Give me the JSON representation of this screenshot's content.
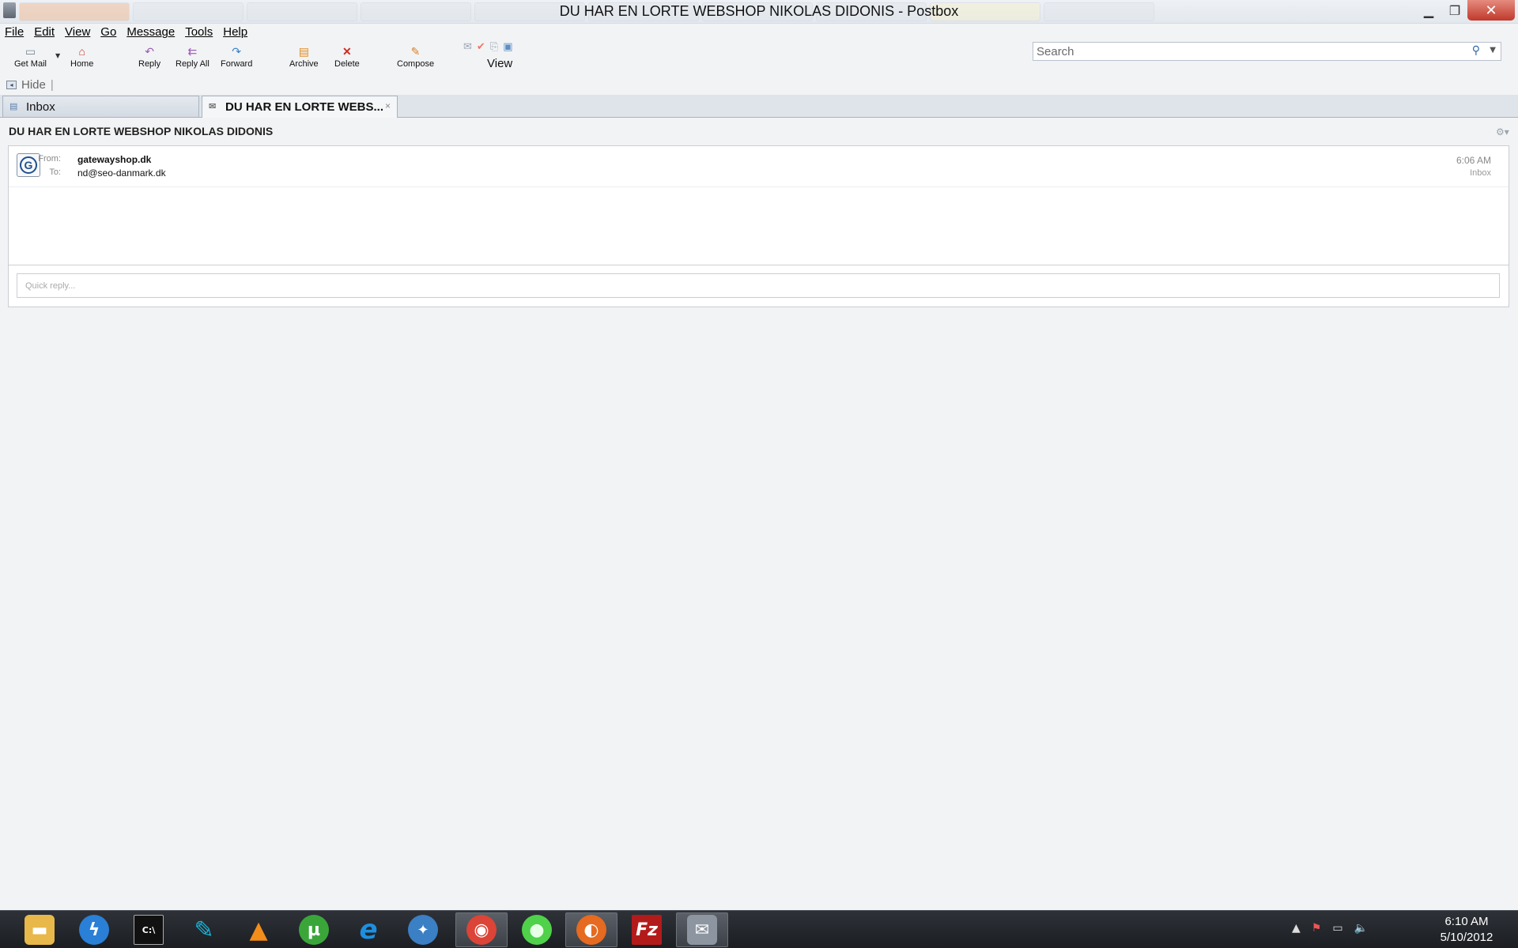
{
  "window": {
    "title": "DU HAR EN LORTE WEBSHOP NIKOLAS DIDONIS - Postbox",
    "minimize": "▁",
    "maximize": "❐",
    "close": "✕"
  },
  "menu": [
    "File",
    "Edit",
    "View",
    "Go",
    "Message",
    "Tools",
    "Help"
  ],
  "toolbar": {
    "get_mail": "Get Mail",
    "home": "Home",
    "reply": "Reply",
    "reply_all": "Reply All",
    "forward": "Forward",
    "archive": "Archive",
    "delete": "Delete",
    "compose": "Compose",
    "view": "View"
  },
  "search": {
    "placeholder": "Search"
  },
  "hide_label": "Hide",
  "tabs": [
    {
      "label": "Inbox",
      "icon": "inbox-icon"
    },
    {
      "label": "DU HAR EN LORTE WEBS...",
      "icon": "envelope-icon",
      "close": "×"
    }
  ],
  "message": {
    "subject": "DU HAR EN LORTE WEBSHOP NIKOLAS DIDONIS",
    "avatar_letter": "G",
    "from_label": "From:",
    "from": "gatewayshop.dk",
    "to_label": "To:",
    "to": "nd@seo-danmark.dk",
    "time": "6:06 AM",
    "folder": "Inbox",
    "quick_reply_placeholder": "Quick reply..."
  },
  "taskbar": {
    "apps": [
      {
        "name": "file-explorer",
        "glyph": "▬",
        "color": "#e8b84a"
      },
      {
        "name": "thunderbolt",
        "glyph": "ϟ",
        "color": "#2a7fd6"
      },
      {
        "name": "command-prompt",
        "glyph": "C:\\",
        "color": "#111111"
      },
      {
        "name": "feather-app",
        "glyph": "✎",
        "color": "#1ab3d8"
      },
      {
        "name": "vlc",
        "glyph": "▲",
        "color": "#f28c1b"
      },
      {
        "name": "utorrent",
        "glyph": "µ",
        "color": "#3aa63a"
      },
      {
        "name": "internet-explorer",
        "glyph": "e",
        "color": "#1d8fe0"
      },
      {
        "name": "safari",
        "glyph": "✦",
        "color": "#3b7fc4"
      },
      {
        "name": "chrome",
        "glyph": "◉",
        "color": "#db4437"
      },
      {
        "name": "green-app",
        "glyph": "●",
        "color": "#4fd14a"
      },
      {
        "name": "firefox",
        "glyph": "◐",
        "color": "#e66a1f"
      },
      {
        "name": "filezilla",
        "glyph": "Fz",
        "color": "#b31b1b"
      },
      {
        "name": "postbox",
        "glyph": "✉",
        "color": "#8c95a0"
      }
    ],
    "time": "6:10 AM",
    "date": "5/10/2012"
  }
}
